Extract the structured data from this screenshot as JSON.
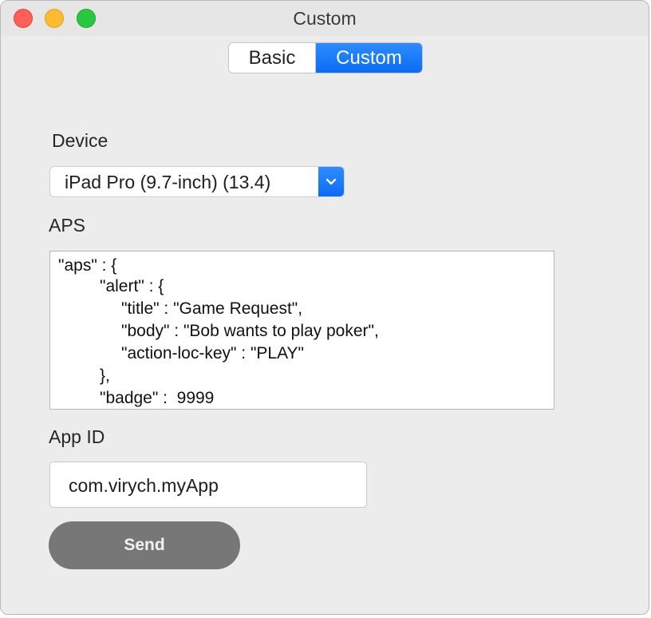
{
  "window": {
    "title": "Custom"
  },
  "tabs": [
    {
      "label": "Basic",
      "selected": false
    },
    {
      "label": "Custom",
      "selected": true
    }
  ],
  "device": {
    "label": "Device",
    "selected_value": "iPad Pro (9.7-inch) (13.4)",
    "icon": "chevron-down-icon"
  },
  "aps": {
    "label": "APS",
    "lines": [
      "\"aps\" : {",
      "\"alert\" : {",
      "\"title\" : \"Game Request\",",
      "\"body\" : \"Bob wants to play poker\",",
      "\"action-loc-key\" : \"PLAY\"",
      "},",
      "\"badge\" :  9999"
    ]
  },
  "app_id": {
    "label": "App ID",
    "value": "com.virych.myApp"
  },
  "send_button": {
    "label": "Send"
  },
  "colors": {
    "accent": "#0a6cf5",
    "button_gray": "#777777",
    "close": "#fe5f57",
    "minimize": "#febc2e",
    "zoom": "#28c840"
  }
}
